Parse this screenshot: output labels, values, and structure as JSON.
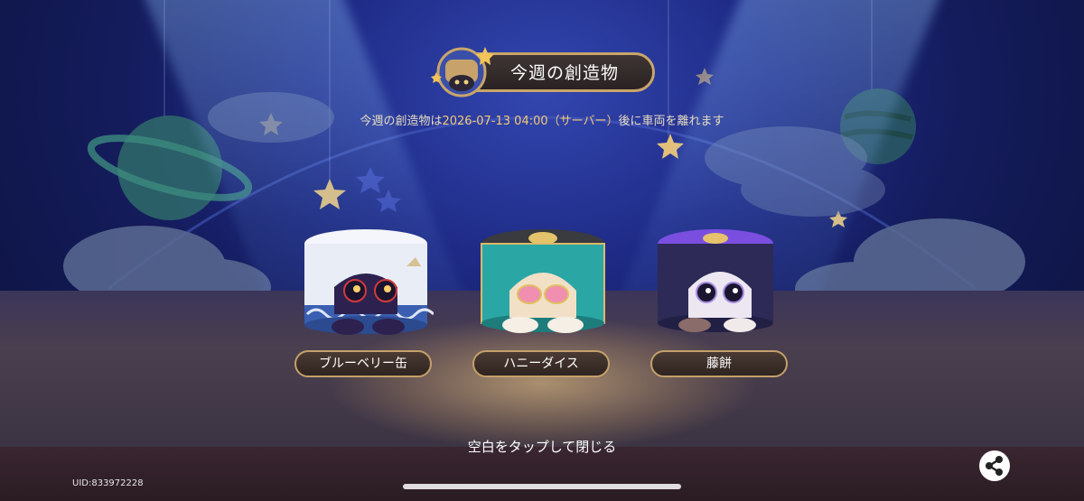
{
  "header": {
    "title": "今週の創造物",
    "badge_icon": "cat-badge-icon"
  },
  "subtitle": {
    "prefix": "今週の創造物は",
    "datetime": "2026-07-13 04:00（サーバー）",
    "suffix": "後に車両を離れます"
  },
  "creatures": [
    {
      "name": "ブルーベリー缶",
      "icon": "blueberry-can-cat-icon"
    },
    {
      "name": "ハニーダイス",
      "icon": "honey-dice-cat-icon"
    },
    {
      "name": "藤餅",
      "icon": "wisteria-mochi-cat-icon"
    }
  ],
  "footer": {
    "close_hint": "空白をタップして閉じる",
    "uid": "UID:833972228",
    "share_icon": "share-icon"
  },
  "colors": {
    "accent_gold": "#c9a56a",
    "highlight_text": "#f4c873"
  }
}
